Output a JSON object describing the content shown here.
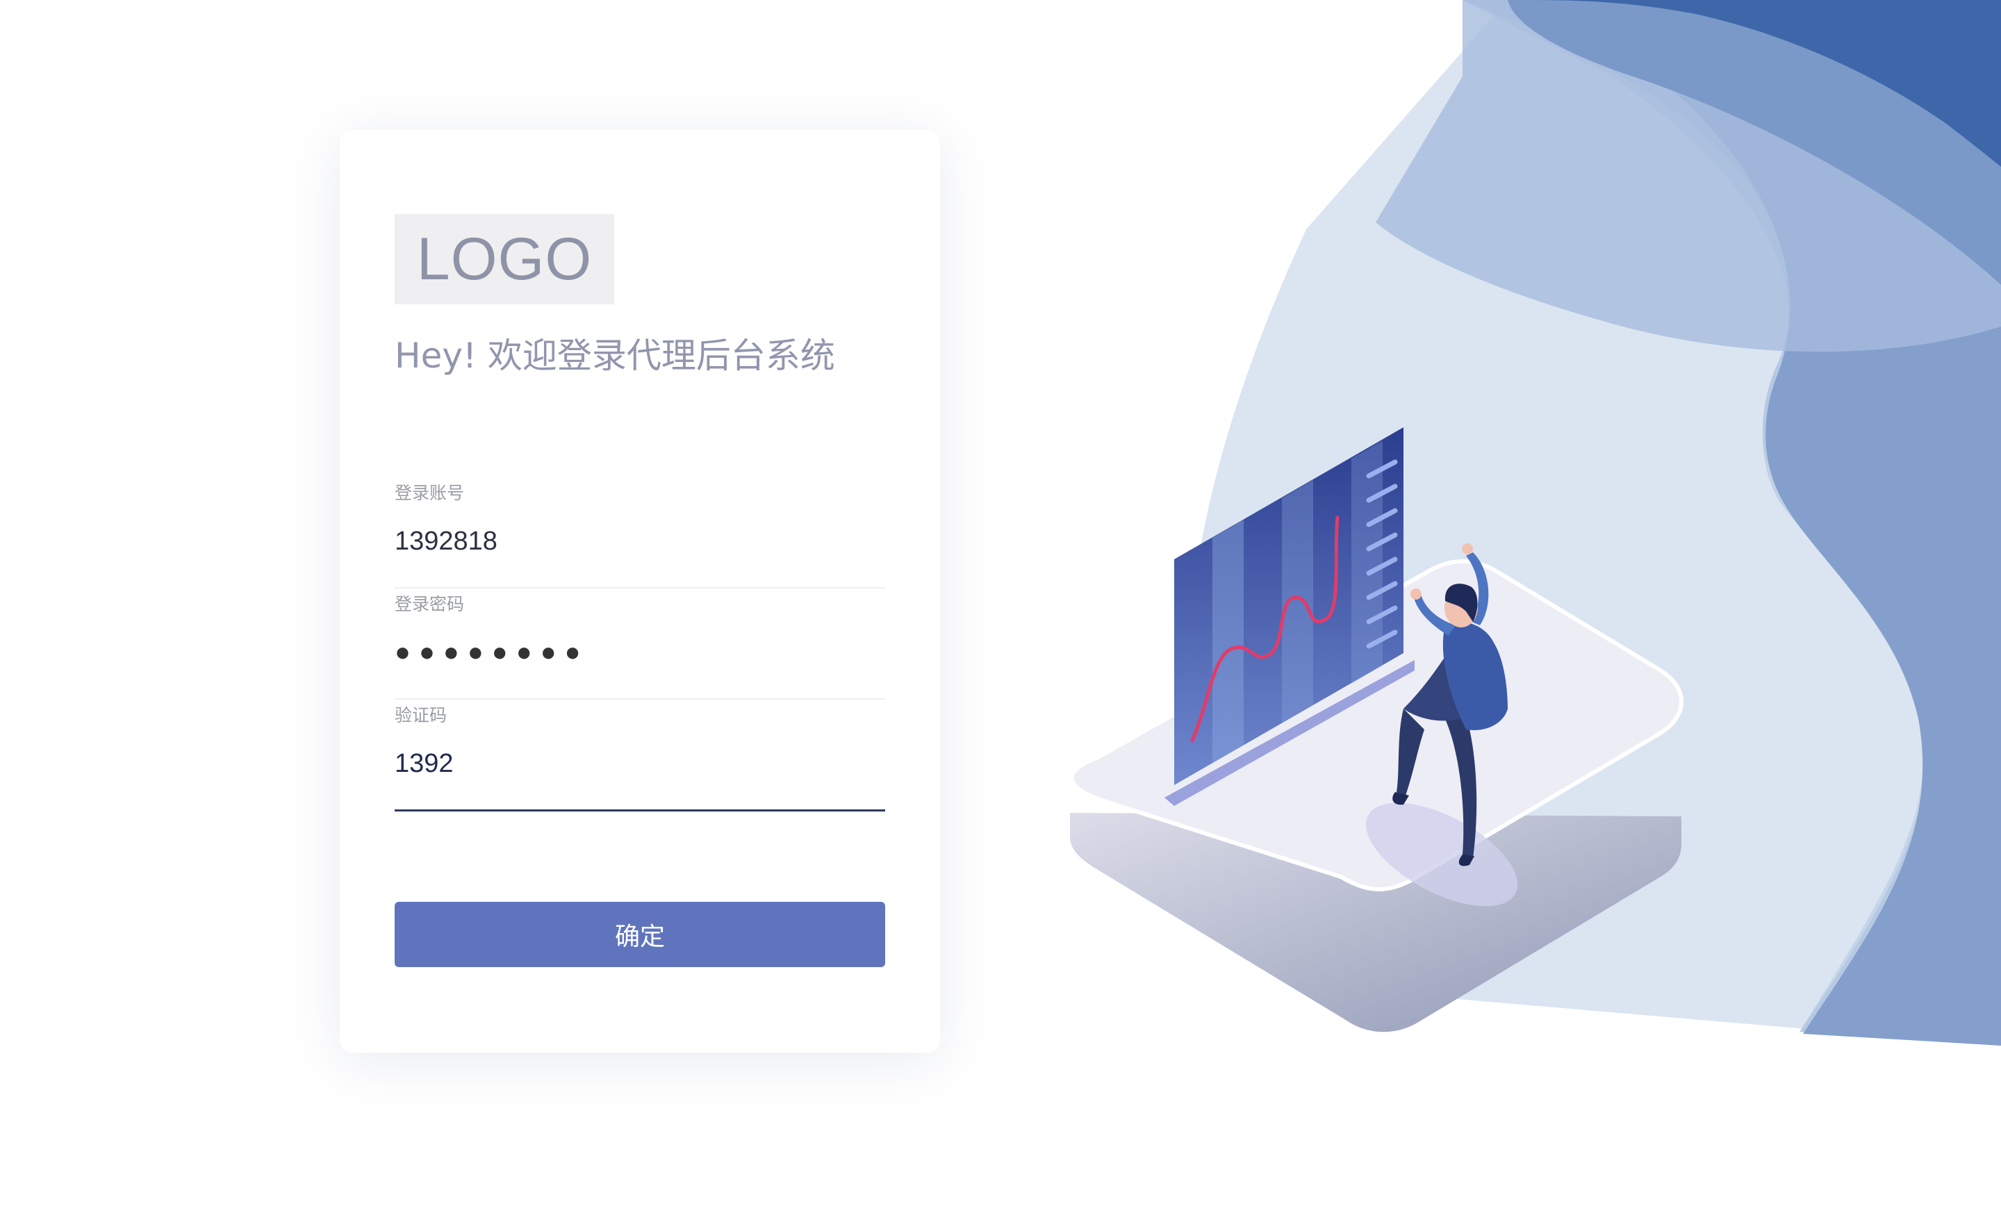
{
  "brand": {
    "logo_text": "LOGO",
    "welcome_title": "Hey! 欢迎登录代理后台系统"
  },
  "form": {
    "account": {
      "label": "登录账号",
      "value": "1392818"
    },
    "password": {
      "label": "登录密码",
      "masked_display": "●●●●●●●●"
    },
    "captcha": {
      "label": "验证码",
      "value": "1392"
    },
    "submit_label": "确定"
  },
  "colors": {
    "primary": "#6074bd",
    "title_gray": "#9196ad",
    "wave_dark": "#3d67a8",
    "wave_mid": "#7797c6",
    "wave_light": "#c7d6ea",
    "platform": "#eeeef7"
  },
  "illustration": {
    "subject": "person-celebrating-next-to-growth-chart-icon"
  }
}
